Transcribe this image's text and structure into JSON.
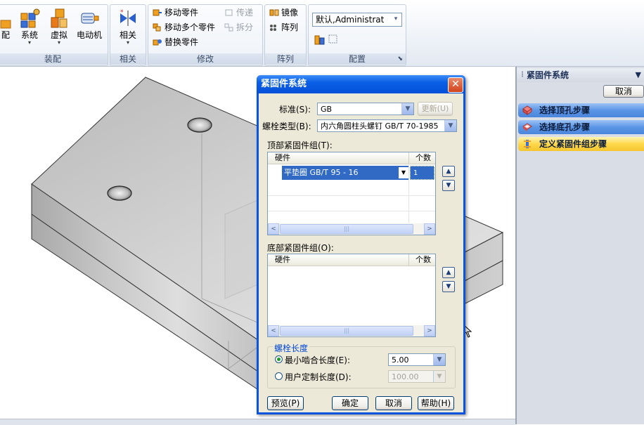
{
  "ribbon": {
    "groups": [
      {
        "id": "assembly",
        "title": "装配",
        "buttons": [
          {
            "label": "配"
          },
          {
            "label": "系统"
          },
          {
            "label": "虚拟"
          },
          {
            "label": "电动机"
          }
        ]
      },
      {
        "id": "related",
        "title": "相关",
        "buttons": [
          {
            "label": "相关"
          }
        ]
      },
      {
        "id": "modify",
        "title": "修改",
        "buttons": [
          {
            "label": "移动零件"
          },
          {
            "label": "移动多个零件"
          },
          {
            "label": "替换零件"
          },
          {
            "label": "传递"
          },
          {
            "label": "拆分"
          }
        ]
      },
      {
        "id": "array",
        "title": "阵列",
        "buttons": [
          {
            "label": "镜像"
          },
          {
            "label": "阵列"
          }
        ]
      },
      {
        "id": "config",
        "title": "配置",
        "select": "默认,Administrat"
      }
    ]
  },
  "pane": {
    "title": "紧固件系统",
    "cancel": "取消",
    "steps": [
      {
        "label": "选择顶孔步骤",
        "active": false
      },
      {
        "label": "选择底孔步骤",
        "active": false
      },
      {
        "label": "定义紧固件组步骤",
        "active": true
      }
    ]
  },
  "dialog": {
    "title": "紧固件系统",
    "close": "✕",
    "standard_label": "标准(S):",
    "standard_value": "GB",
    "update_button": "更新(U)",
    "bolt_type_label": "螺栓类型(B):",
    "bolt_type_value": "内六角圆柱头螺钉 GB/T 70-1985",
    "top_group_label": "顶部紧固件组(T):",
    "grid_headers": {
      "hardware": "硬件",
      "count": "个数"
    },
    "top_rows": [
      {
        "hardware": "平垫圈 GB/T 95 - 16",
        "count": "1"
      }
    ],
    "bottom_group_label": "底部紧固件组(O):",
    "bolt_length_title": "螺栓长度",
    "min_engage_label": "最小啮合长度(E):",
    "min_engage_value": "5.00",
    "user_defined_label": "用户定制长度(D):",
    "user_defined_value": "100.00",
    "buttons": {
      "preview": "预览(P)",
      "ok": "确定",
      "cancel": "取消",
      "help": "帮助(H)"
    }
  }
}
